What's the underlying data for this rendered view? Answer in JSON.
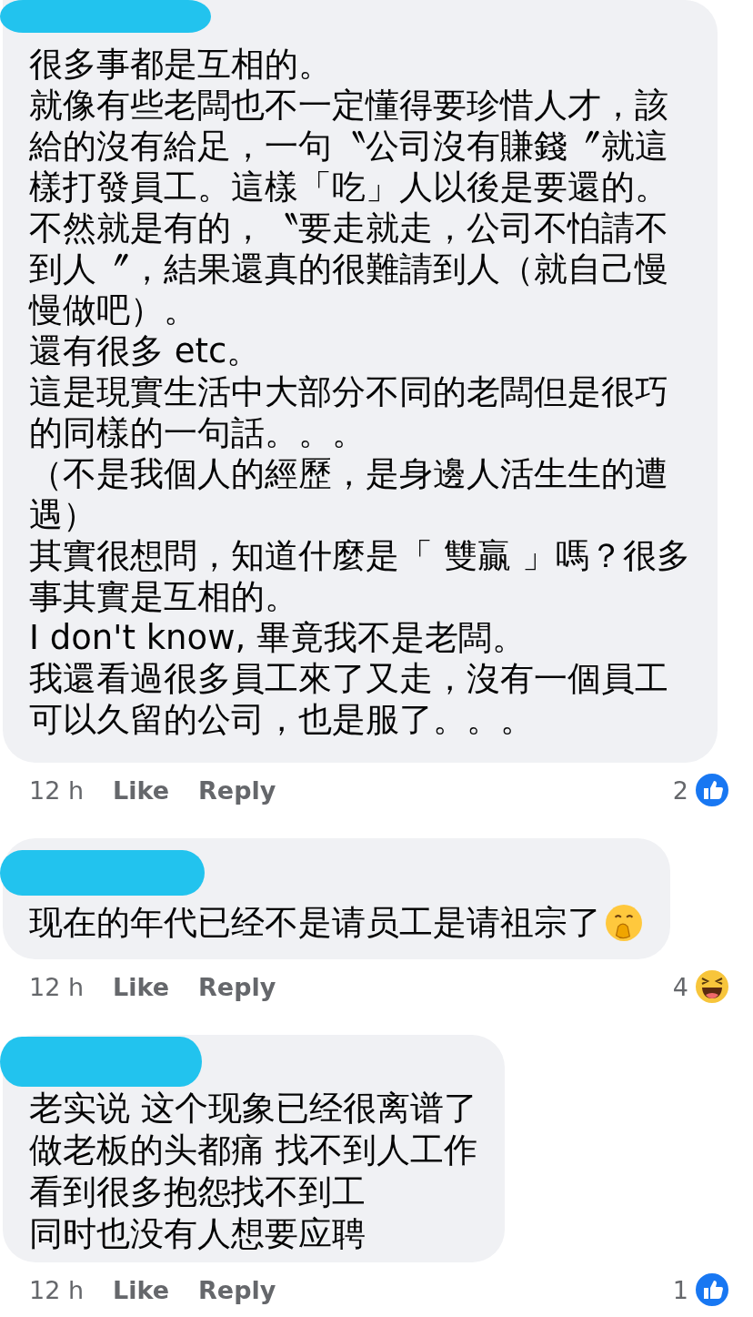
{
  "comments": [
    {
      "lines": [
        "很多事都是互相的。",
        "就像有些老闆也不一定懂得要珍惜人才，該",
        "給的沒有給足，一句〝公司沒有賺錢〞就這",
        "樣打發員工。這樣「吃」人以後是要還的。",
        "不然就是有的，〝要走就走，公司不怕請不",
        "到人〞，結果還真的很難請到人（就自己慢",
        "慢做吧）。",
        "還有很多 etc。",
        "這是現實生活中大部分不同的老闆但是很巧",
        "的同樣的一句話。。。",
        "（不是我個人的經歷，是身邊人活生生的遭",
        "遇）",
        "其實很想問，知道什麼是「 雙贏 」嗎？很多",
        "事其實是互相的。",
        "I don't know, 畢竟我不是老闆。",
        "我還看過很多員工來了又走，沒有一個員工",
        "可以久留的公司，也是服了。。。"
      ],
      "trailing_emoji": false,
      "time": "12 h",
      "like": "Like",
      "reply": "Reply",
      "reaction": {
        "kind": "like",
        "count": "2"
      }
    },
    {
      "lines": [
        "现在的年代已经不是请员工是请祖宗了"
      ],
      "trailing_emoji": true,
      "time": "12 h",
      "like": "Like",
      "reply": "Reply",
      "reaction": {
        "kind": "haha",
        "count": "4"
      }
    },
    {
      "lines": [
        "老实说 这个现象已经很离谱了",
        "做老板的头都痛 找不到人工作",
        "看到很多抱怨找不到工",
        "同时也没有人想要应聘"
      ],
      "trailing_emoji": false,
      "time": "12 h",
      "like": "Like",
      "reply": "Reply",
      "reaction": {
        "kind": "like",
        "count": "1"
      }
    }
  ]
}
